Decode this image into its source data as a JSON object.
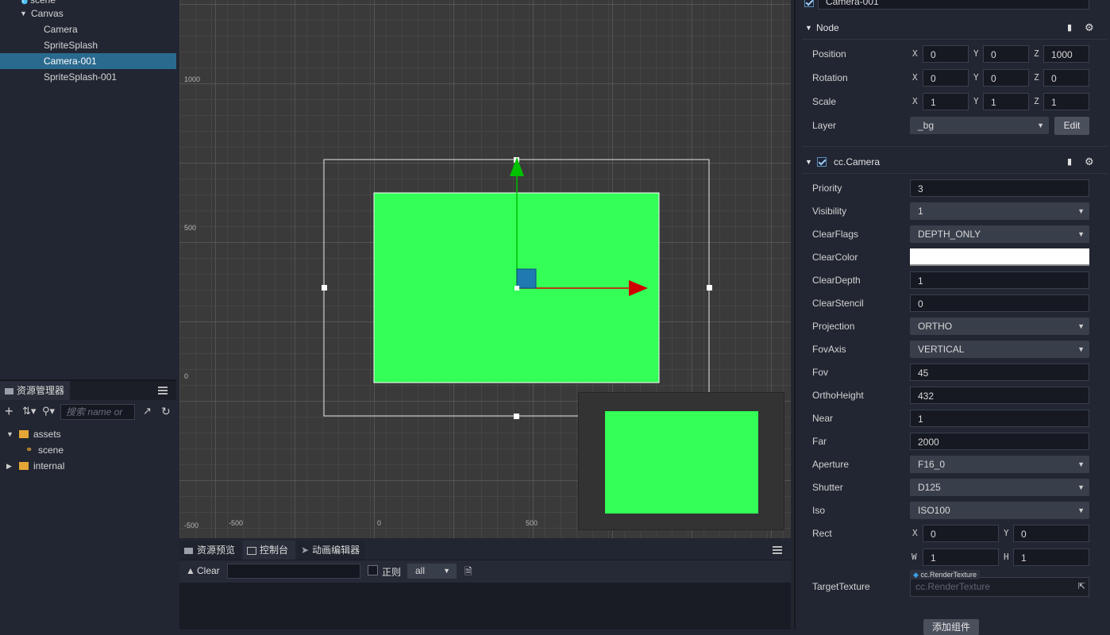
{
  "hierarchy": {
    "items": [
      {
        "label": "scene"
      },
      {
        "label": "Canvas"
      },
      {
        "label": "Camera"
      },
      {
        "label": "SpriteSplash"
      },
      {
        "label": "Camera-001"
      },
      {
        "label": "SpriteSplash-001"
      }
    ]
  },
  "assets_panel": {
    "title": "资源管理器",
    "search_placeholder": "搜索 name or",
    "tree": [
      {
        "label": "assets"
      },
      {
        "label": "scene"
      },
      {
        "label": "internal"
      }
    ]
  },
  "scene": {
    "grid_labels": {
      "y1000": "1000",
      "y500": "500",
      "y0": "0",
      "ym500": "-500",
      "xm500": "-500",
      "x0": "0",
      "x500": "500"
    }
  },
  "console": {
    "tabs": [
      {
        "label": "资源预览"
      },
      {
        "label": "控制台"
      },
      {
        "label": "动画编辑器"
      }
    ],
    "clear_label": "Clear",
    "regex_label": "正则",
    "level_value": "all"
  },
  "inspector": {
    "node_name": "Camera-001",
    "node_section": {
      "title": "Node",
      "position": {
        "label": "Position",
        "x": "0",
        "y": "0",
        "z": "1000"
      },
      "rotation": {
        "label": "Rotation",
        "x": "0",
        "y": "0",
        "z": "0"
      },
      "scale": {
        "label": "Scale",
        "x": "1",
        "y": "1",
        "z": "1"
      },
      "layer": {
        "label": "Layer",
        "value": "_bg",
        "edit_label": "Edit"
      }
    },
    "camera_section": {
      "title": "cc.Camera",
      "priority": {
        "label": "Priority",
        "value": "3"
      },
      "visibility": {
        "label": "Visibility",
        "value": "1"
      },
      "clear_flags": {
        "label": "ClearFlags",
        "value": "DEPTH_ONLY"
      },
      "clear_color": {
        "label": "ClearColor",
        "color": "#ffffff"
      },
      "clear_depth": {
        "label": "ClearDepth",
        "value": "1"
      },
      "clear_stencil": {
        "label": "ClearStencil",
        "value": "0"
      },
      "projection": {
        "label": "Projection",
        "value": "ORTHO"
      },
      "fov_axis": {
        "label": "FovAxis",
        "value": "VERTICAL"
      },
      "fov": {
        "label": "Fov",
        "value": "45"
      },
      "ortho_height": {
        "label": "OrthoHeight",
        "value": "432"
      },
      "near": {
        "label": "Near",
        "value": "1"
      },
      "far": {
        "label": "Far",
        "value": "2000"
      },
      "aperture": {
        "label": "Aperture",
        "value": "F16_0"
      },
      "shutter": {
        "label": "Shutter",
        "value": "D125"
      },
      "iso": {
        "label": "Iso",
        "value": "ISO100"
      },
      "rect": {
        "label": "Rect",
        "x": "0",
        "y": "0",
        "w": "1",
        "h": "1"
      },
      "target_texture": {
        "label": "TargetTexture",
        "type_badge": "cc.RenderTexture",
        "placeholder": "cc.RenderTexture"
      }
    },
    "add_component_label": "添加组件"
  },
  "colors": {
    "selection": "#2b6a8f",
    "sprite_green": "#33ff57",
    "gizmo_x": "#e00000",
    "gizmo_y": "#00c000"
  }
}
